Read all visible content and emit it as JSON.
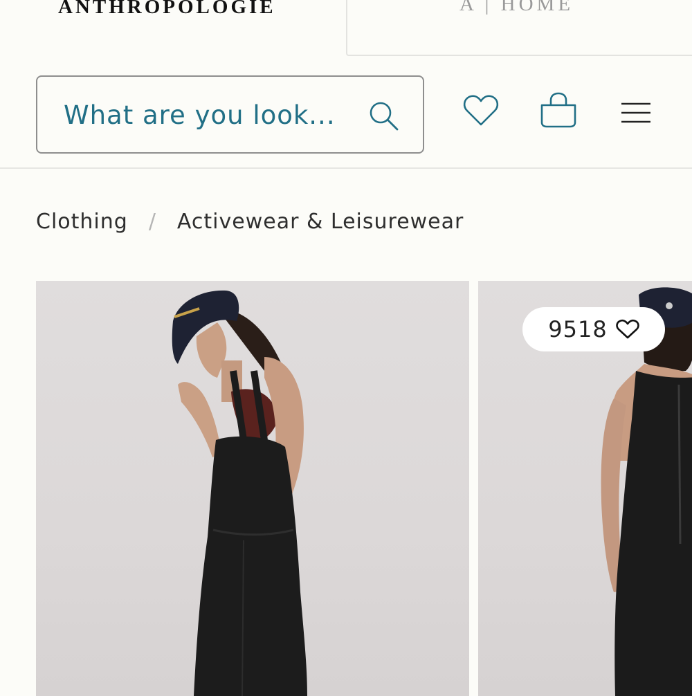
{
  "header": {
    "brand": "ANTHROPOLOGIE",
    "home_tab": "A | HOME"
  },
  "search": {
    "placeholder": "What are you look..."
  },
  "icons": {
    "search": "search-icon",
    "wishlist": "heart-icon",
    "cart": "shopping-bag-icon",
    "menu": "hamburger-menu-icon"
  },
  "colors": {
    "accent": "#216f86",
    "background": "#fcfcf8"
  },
  "breadcrumb": {
    "items": [
      "Clothing",
      "Activewear & Leisurewear"
    ],
    "separator": "/"
  },
  "products": [
    {
      "image": "model-black-overalls-side-view"
    },
    {
      "image": "model-black-overalls-back-view",
      "likes": "9518"
    }
  ]
}
